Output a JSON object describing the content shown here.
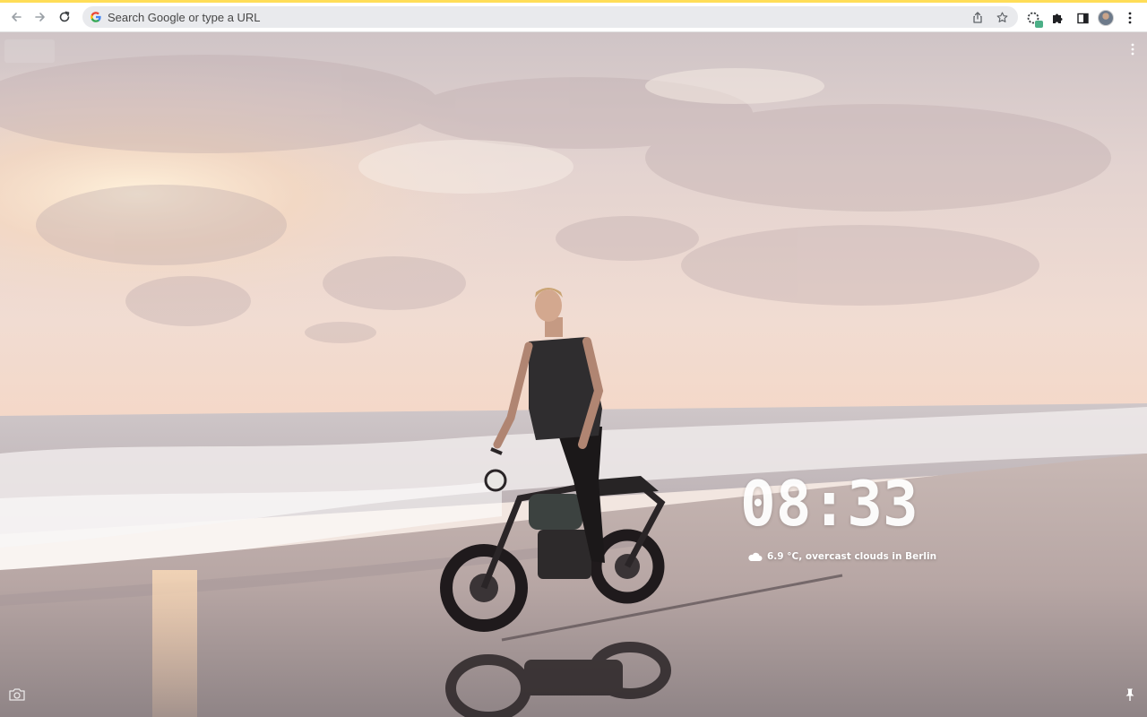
{
  "browser": {
    "omnibox": {
      "placeholder": "Search Google or type a URL",
      "value": ""
    },
    "extension_badge": "1",
    "icons": {
      "back": "arrow-left-icon",
      "forward": "arrow-right-icon",
      "reload": "reload-icon",
      "google": "google-g-icon",
      "share": "share-icon",
      "bookmark": "star-icon",
      "extension": "spinner-icon",
      "extensions_menu": "puzzle-icon",
      "side_panel": "side-panel-icon",
      "profile": "avatar",
      "menu": "kebab-menu-icon"
    },
    "accent_color": "#ffdd57"
  },
  "newtab": {
    "clock": "08:33",
    "weather": {
      "icon": "cloud-icon",
      "text": "6.9 °C, overcast clouds in Berlin"
    },
    "icons": {
      "menu": "kebab-menu-icon",
      "camera": "camera-icon",
      "pin": "pin-icon"
    }
  }
}
